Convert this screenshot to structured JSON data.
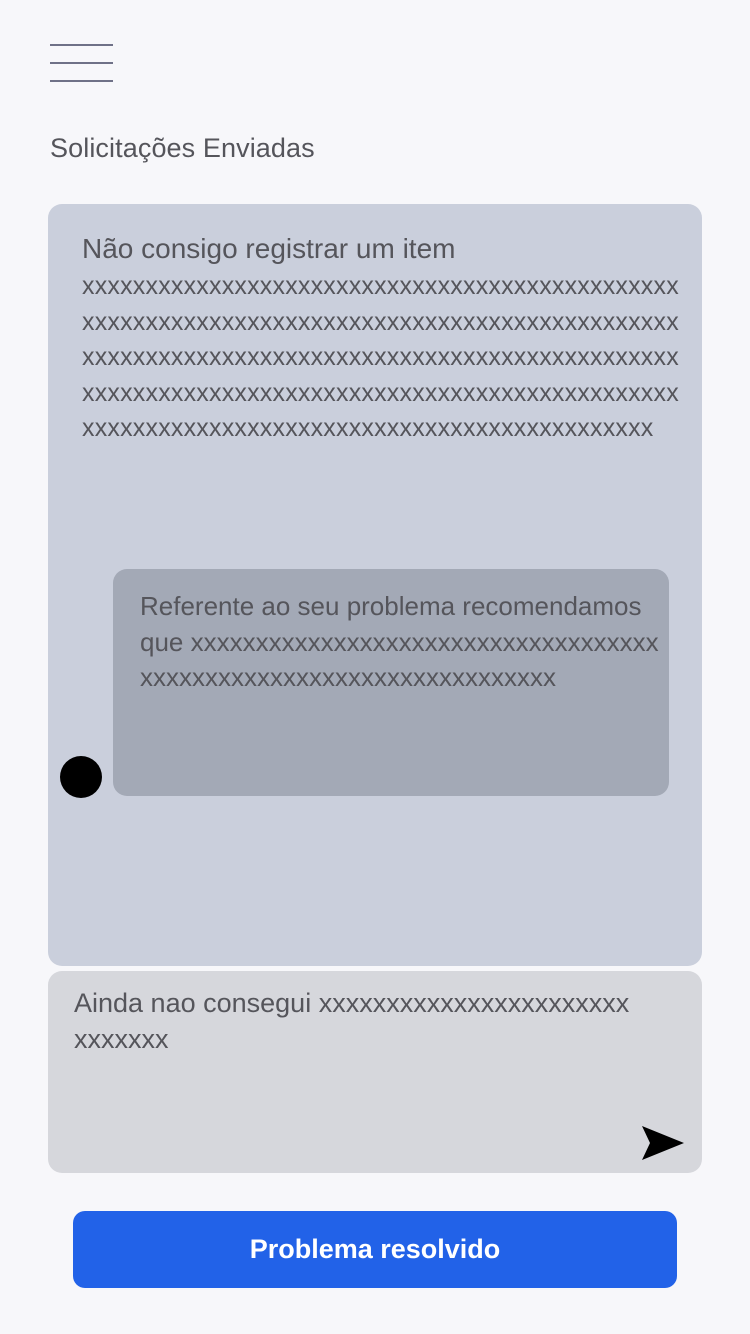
{
  "header": {
    "menu_icon": "hamburger-menu-icon",
    "title": "Solicitações Enviadas"
  },
  "thread": {
    "request_title": "Não consigo registrar um item",
    "request_body": "xxxxxxxxxxxxxxxxxxxxxxxxxxxxxxxxxxxxxxxxxxxxxxxxxxxxxxxxxxxxxxxxxxxxxxxxxxxxxxxxxxxxxxxxxxxxxxxxxxxxxxxxxxxxxxxxxxxxxxxxxxxxxxxxxxxxxxxxxxxxxxxxxxxxxxxxxxxxxxxxxxxxxxxxxxxxxxxxxxxxxxxxxxxxxxxxxxxxxxxxxxxxxxxxxxxxxxxxxxxxxxxxxxxxxxxxx",
    "reply_text": "Referente ao seu problema recomendamos que xxxxxxxxxxxxxxxxxxxxxxxxxxxxxxxxxxxxxxxxxxxxxxxxxxxxxxxxxxxxxxxxxxxx",
    "avatar_icon": "support-avatar-dot"
  },
  "compose": {
    "value": "Ainda nao consegui xxxxxxxxxxxxxxxxxxxxxxxxxxxxxx",
    "send_icon": "send-arrow-icon"
  },
  "actions": {
    "resolve_label": "Problema resolvido"
  },
  "colors": {
    "background": "#f7f7fa",
    "thread_bg": "#cacfdc",
    "reply_bg": "#a3a9b6",
    "compose_bg": "#d6d7dc",
    "primary": "#2262e8"
  }
}
